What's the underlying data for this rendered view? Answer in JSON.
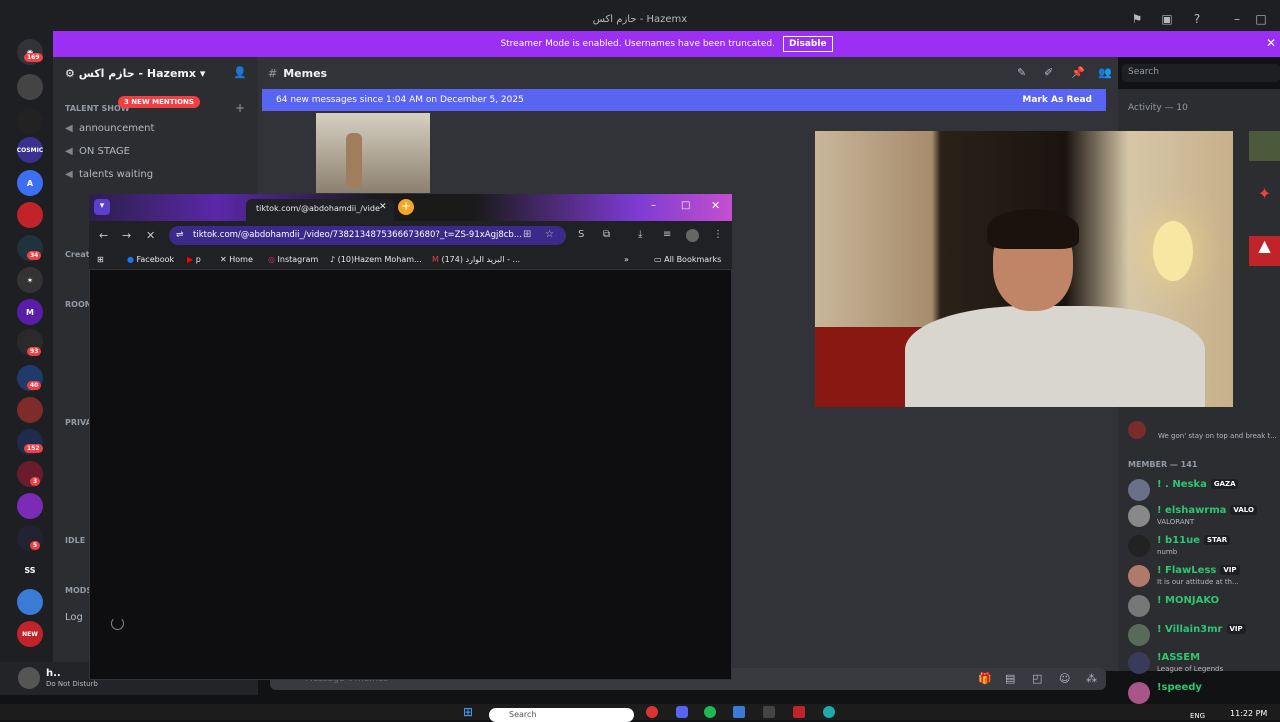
{
  "window": {
    "title": "حازم اكس - Hazemx"
  },
  "streamer_banner": {
    "text": "Streamer Mode is enabled. Usernames have been truncated.",
    "button": "Disable"
  },
  "servers": {
    "home_badge": "169",
    "badges": [
      "34",
      "93",
      "40",
      "152",
      "3",
      "5"
    ],
    "labels": [
      "COSMIC",
      "M",
      "SS",
      "NEW"
    ]
  },
  "channels": {
    "server_name": "حازم اكس - Hazemx",
    "mention_badge": "3 NEW MENTIONS",
    "category_talent": "TALENT SHOW",
    "items": [
      "announcement",
      "ON STAGE",
      "talents waiting"
    ],
    "categories": [
      "Creat",
      "ROOM",
      "PRIVA",
      "IDLE",
      "MODS"
    ],
    "partial": [
      "Log"
    ]
  },
  "user": {
    "name": "h..",
    "status": "Do Not Disturb"
  },
  "header": {
    "channel": "Memes"
  },
  "new_messages": {
    "text": "64 new messages since 1:04 AM on December 5, 2025",
    "action": "Mark As Read"
  },
  "search": {
    "placeholder": "Search"
  },
  "activity": {
    "label": "Activity — 10"
  },
  "members": {
    "header": "MEMBER — 141",
    "activity_status": "We gon' stay on top and break t...",
    "list": [
      {
        "name": "! . Neska",
        "tag": "GAZA",
        "status": ""
      },
      {
        "name": "! elshawrma",
        "tag": "VALO",
        "status": "VALORANT"
      },
      {
        "name": "! b11ue",
        "tag": "STAR",
        "status": "numb"
      },
      {
        "name": "! FlawLess",
        "tag": "VIP",
        "status": "It is our attitude at th..."
      },
      {
        "name": "! MONJAKO",
        "tag": "",
        "status": ""
      },
      {
        "name": "! Villain3mr",
        "tag": "VIP",
        "status": ""
      },
      {
        "name": "!ASSEM",
        "tag": "",
        "status": "League of Legends"
      },
      {
        "name": "!speedy",
        "tag": "",
        "status": ""
      }
    ]
  },
  "browser": {
    "tab_title": "tiktok.com/@abdohamdii_/vide",
    "url": "tiktok.com/@abdohamdii_/video/7382134875366673680?_t=ZS-91xAgj8cb...",
    "bookmarks": [
      "Facebook",
      "p",
      "Home",
      "Instagram",
      "(10)Hazem Moham...",
      "(174) البريد الوارد - ...",
      "All Bookmarks"
    ]
  },
  "message_input": {
    "placeholder": "Message #memes"
  },
  "taskbar": {
    "search": "Search",
    "lang": "ENG",
    "time": "11:22 PM"
  },
  "colors": {
    "blurple": "#5865f2",
    "streamer": "#9b2ff3",
    "online": "#2dc770",
    "danger": "#f23f43"
  }
}
